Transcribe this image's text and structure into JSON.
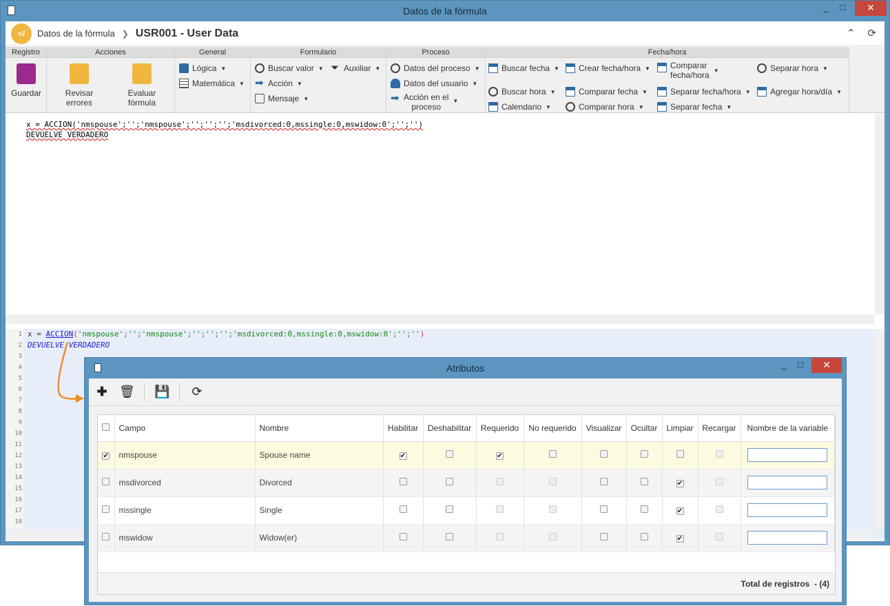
{
  "window": {
    "title": "Datos de la fórmula",
    "minimize": "_",
    "maximize": "□",
    "close": "✕"
  },
  "header": {
    "breadcrumb": "Datos de la fórmula",
    "title": "USR001 - User Data"
  },
  "ribbon": {
    "groups": [
      "Registro",
      "Acciones",
      "General",
      "Formulario",
      "Proceso",
      "Fecha/hora"
    ],
    "registro": {
      "save": "Guardar"
    },
    "acciones": {
      "check": "Revisar errores",
      "evaluate": "Evaluar fórmula"
    },
    "general": {
      "logic": "Lógica",
      "math": "Matemática"
    },
    "formulario": {
      "search": "Buscar valor",
      "aux": "Auxiliar",
      "action": "Acción",
      "message": "Mensaje"
    },
    "proceso": {
      "process_data": "Datos del proceso",
      "user_data": "Datos del usuario",
      "action_line1": "Acción en el",
      "action_line2": "proceso"
    },
    "fecha": {
      "search_date": "Buscar fecha",
      "create_datetime": "Crear fecha/hora",
      "compare_line1": "Comparar",
      "compare_line2": "fecha/hora",
      "split_hour": "Separar hora",
      "search_hour": "Buscar hora",
      "compare_date": "Comparar fecha",
      "split_datetime": "Separar fecha/hora",
      "add_hourday": "Agregar hora/día",
      "calendar": "Calendario",
      "compare_hour": "Comparar hora",
      "split_date": "Separar fecha"
    }
  },
  "editor": {
    "line1": "x = ACCION('nmspouse';'';'nmspouse';'';'';'';'msdivorced:0,mssingle:0,mswidow:0';'';'')",
    "line2": "DEVUELVE VERDADERO"
  },
  "code": {
    "line_numbers": [
      "1",
      "2",
      "3",
      "4",
      "5",
      "6",
      "7",
      "8",
      "9",
      "10",
      "11",
      "12",
      "13",
      "14",
      "15",
      "16",
      "17",
      "18"
    ],
    "l1_var": "x = ",
    "l1_fn": "ACCION",
    "l1_open": "(",
    "l1_args": "'nmspouse';'';'nmspouse';'';'';'';'msdivorced:0,mssingle:0,mswidow:0';'';''",
    "l1_close": ")",
    "l2": "DEVUELVE VERDADERO"
  },
  "attributes": {
    "title": "Atributos",
    "columns": [
      "Campo",
      "Nombre",
      "Habilitar",
      "Deshabilitar",
      "Requerido",
      "No requerido",
      "Visualizar",
      "Ocultar",
      "Limpiar",
      "Recargar",
      "Nombre de la variable"
    ],
    "rows": [
      {
        "campo": "nmspouse",
        "nombre": "Spouse name",
        "checked": true,
        "habilitar": true,
        "deshabilitar": false,
        "requerido": true,
        "no_requerido": false,
        "visualizar": false,
        "ocultar": false,
        "limpiar": false,
        "recargar": false,
        "variable": ""
      },
      {
        "campo": "msdivorced",
        "nombre": "Divorced",
        "checked": false,
        "habilitar": false,
        "deshabilitar": false,
        "requerido": false,
        "no_requerido": false,
        "visualizar": false,
        "ocultar": false,
        "limpiar": true,
        "recargar": false,
        "variable": ""
      },
      {
        "campo": "mssingle",
        "nombre": "Single",
        "checked": false,
        "habilitar": false,
        "deshabilitar": false,
        "requerido": false,
        "no_requerido": false,
        "visualizar": false,
        "ocultar": false,
        "limpiar": true,
        "recargar": false,
        "variable": ""
      },
      {
        "campo": "mswidow",
        "nombre": "Widow(er)",
        "checked": false,
        "habilitar": false,
        "deshabilitar": false,
        "requerido": false,
        "no_requerido": false,
        "visualizar": false,
        "ocultar": false,
        "limpiar": true,
        "recargar": false,
        "variable": ""
      }
    ],
    "total_label": "Total de registros",
    "total_value": "- (4)"
  },
  "colors": {
    "window": "#5b95c0",
    "close": "#c7463c",
    "arrow": "#f08a24",
    "accent": "#2f6aa3"
  }
}
